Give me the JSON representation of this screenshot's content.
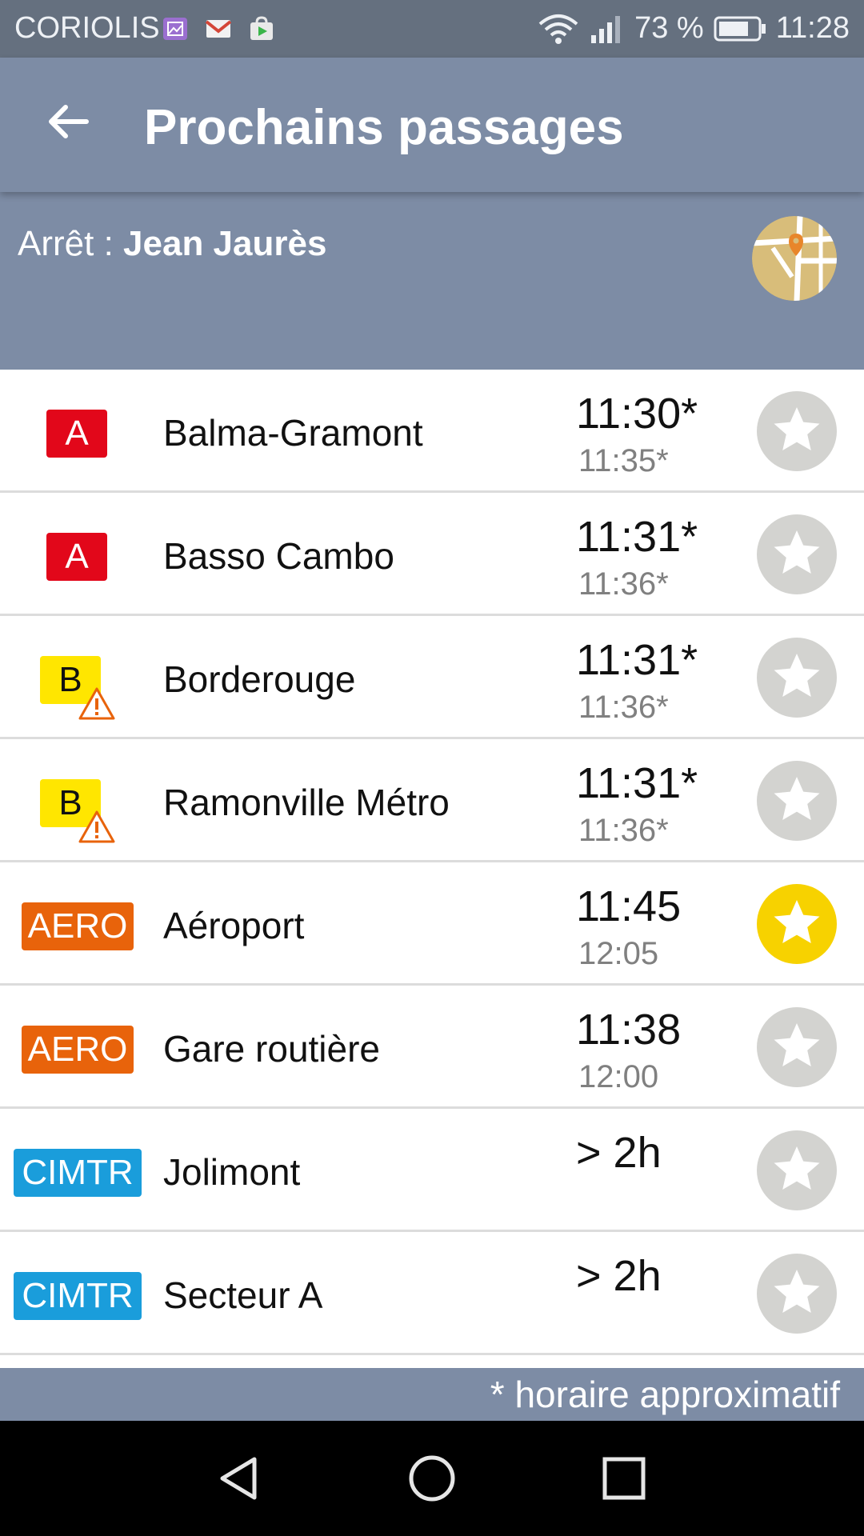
{
  "statusbar": {
    "carrier": "CORIOLIS",
    "battery": "73 %",
    "time": "11:28"
  },
  "appbar": {
    "title": "Prochains passages"
  },
  "stop": {
    "prefix": "Arrêt : ",
    "name": "Jean Jaurès"
  },
  "departures": [
    {
      "line": "A",
      "destination": "Balma-Gramont",
      "next": "11:30*",
      "following": "11:35*",
      "favorite": false,
      "alert": false
    },
    {
      "line": "A",
      "destination": "Basso Cambo",
      "next": "11:31*",
      "following": "11:36*",
      "favorite": false,
      "alert": false
    },
    {
      "line": "B",
      "destination": "Borderouge",
      "next": "11:31*",
      "following": "11:36*",
      "favorite": false,
      "alert": true
    },
    {
      "line": "B",
      "destination": "Ramonville Métro",
      "next": "11:31*",
      "following": "11:36*",
      "favorite": false,
      "alert": true
    },
    {
      "line": "AERO",
      "destination": "Aéroport",
      "next": "11:45",
      "following": "12:05",
      "favorite": true,
      "alert": false
    },
    {
      "line": "AERO",
      "destination": "Gare routière",
      "next": "11:38",
      "following": "12:00",
      "favorite": false,
      "alert": false
    },
    {
      "line": "CIMTR",
      "destination": "Jolimont",
      "next": "> 2h",
      "following": "",
      "favorite": false,
      "alert": false
    },
    {
      "line": "CIMTR",
      "destination": "Secteur A",
      "next": "> 2h",
      "following": "",
      "favorite": false,
      "alert": false
    }
  ],
  "footnote": "* horaire approximatif",
  "colors": {
    "header": "#7d8ca5",
    "statusbar": "#65707f",
    "line_A": "#e2071a",
    "line_B": "#ffe600",
    "line_AERO": "#e8630b",
    "line_CIMTR": "#1a9ddb",
    "favorite_on": "#f7d200",
    "favorite_off": "#d3d3d0"
  }
}
